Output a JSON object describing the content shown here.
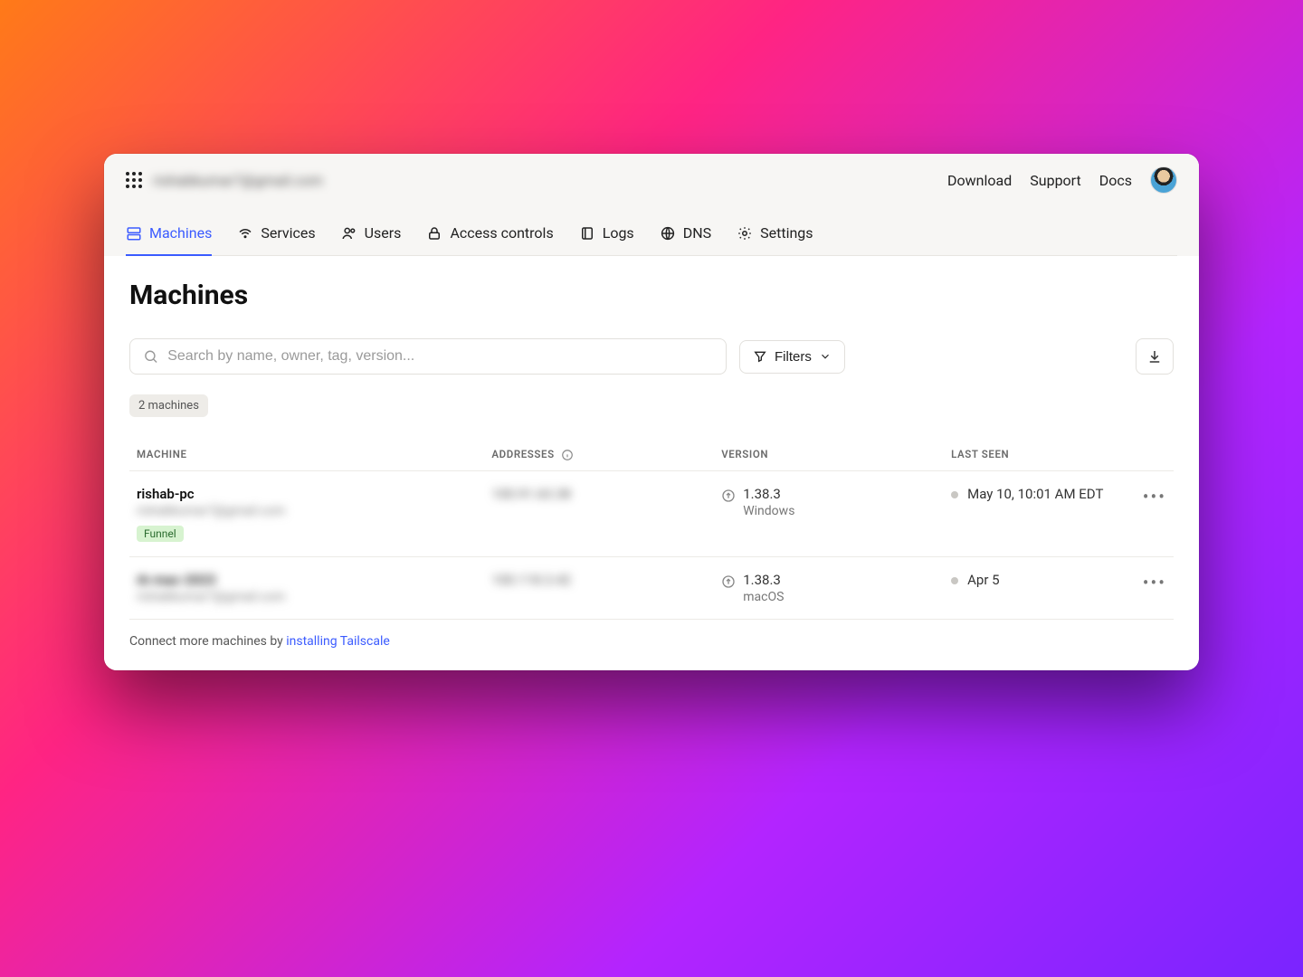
{
  "header": {
    "org_name": "rishabkumar7@gmail.com",
    "links": [
      "Download",
      "Support",
      "Docs"
    ]
  },
  "tabs": [
    {
      "label": "Machines",
      "icon": "machines"
    },
    {
      "label": "Services",
      "icon": "services"
    },
    {
      "label": "Users",
      "icon": "users"
    },
    {
      "label": "Access controls",
      "icon": "lock"
    },
    {
      "label": "Logs",
      "icon": "book"
    },
    {
      "label": "DNS",
      "icon": "globe"
    },
    {
      "label": "Settings",
      "icon": "gear"
    }
  ],
  "page": {
    "title": "Machines",
    "search_placeholder": "Search by name, owner, tag, version...",
    "filters_label": "Filters",
    "count_chip": "2 machines",
    "columns": {
      "machine": "MACHINE",
      "addresses": "ADDRESSES",
      "version": "VERSION",
      "last_seen": "LAST SEEN"
    },
    "footer_prefix": "Connect more machines by ",
    "footer_link": "installing Tailscale"
  },
  "rows": [
    {
      "name": "rishab-pc",
      "owner": "rishabkumar7@gmail.com",
      "badge": "Funnel",
      "address": "100.91.63.38",
      "version": "1.38.3",
      "os": "Windows",
      "last_seen": "May 10, 10:01 AM EDT"
    },
    {
      "name": "rk-mac-2023",
      "owner": "rishabkumar7@gmail.com",
      "badge": "",
      "address": "100.118.3.42",
      "version": "1.38.3",
      "os": "macOS",
      "last_seen": "Apr 5"
    }
  ]
}
